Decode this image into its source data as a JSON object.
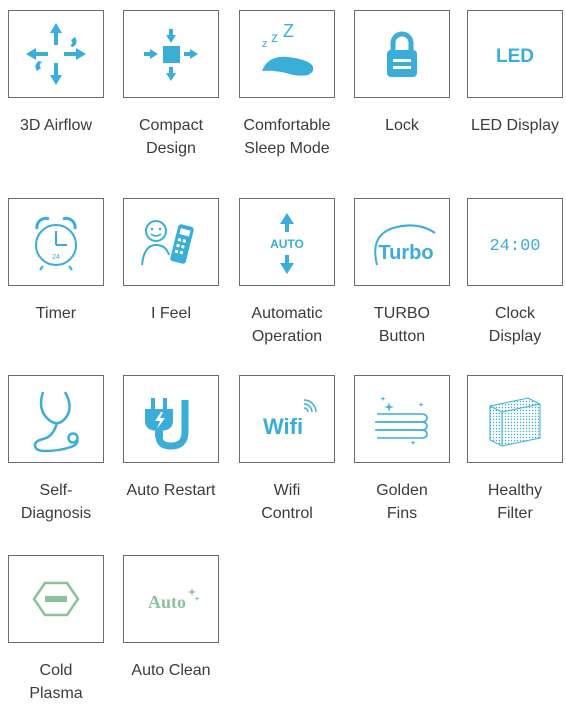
{
  "features": [
    {
      "icon": "airflow-3d-icon",
      "lines": [
        "3D Airflow"
      ]
    },
    {
      "icon": "compact-design-icon",
      "lines": [
        "Compact",
        "Design"
      ]
    },
    {
      "icon": "sleep-mode-icon",
      "lines": [
        "Comfortable",
        "Sleep Mode"
      ],
      "glyph": "Z Z Z"
    },
    {
      "icon": "lock-icon",
      "lines": [
        "Lock"
      ]
    },
    {
      "icon": "led-display-icon",
      "lines": [
        "LED Display"
      ],
      "glyph": "LED"
    },
    {
      "icon": "alarm-clock-icon",
      "lines": [
        "Timer"
      ],
      "glyph": "24"
    },
    {
      "icon": "i-feel-remote-icon",
      "lines": [
        "I Feel"
      ]
    },
    {
      "icon": "auto-operation-icon",
      "lines": [
        "Automatic",
        "Operation"
      ],
      "glyph": "AUTO"
    },
    {
      "icon": "turbo-icon",
      "lines": [
        "TURBO",
        "Button"
      ],
      "glyph": "Turbo"
    },
    {
      "icon": "clock-display-icon",
      "lines": [
        "Clock",
        "Display"
      ],
      "glyph": "24:00"
    },
    {
      "icon": "stethoscope-icon",
      "lines": [
        "Self-",
        "Diagnosis"
      ]
    },
    {
      "icon": "plug-restart-icon",
      "lines": [
        "Auto Restart"
      ]
    },
    {
      "icon": "wifi-icon",
      "lines": [
        "Wifi",
        "Control"
      ],
      "glyph": "Wifi"
    },
    {
      "icon": "golden-fins-icon",
      "lines": [
        "Golden",
        "Fins"
      ]
    },
    {
      "icon": "filter-mesh-icon",
      "lines": [
        "Healthy",
        "Filter"
      ]
    },
    {
      "icon": "hexagon-plasma-icon",
      "lines": [
        "Cold",
        "Plasma"
      ]
    },
    {
      "icon": "auto-clean-icon",
      "lines": [
        "Auto Clean"
      ],
      "glyph": "Auto"
    }
  ],
  "colors": {
    "accent": "#3aaed8",
    "accent_green": "#8cc29b",
    "gold": "#d8c7a1",
    "border": "#6b6b6b",
    "text": "#3b3b3b"
  }
}
